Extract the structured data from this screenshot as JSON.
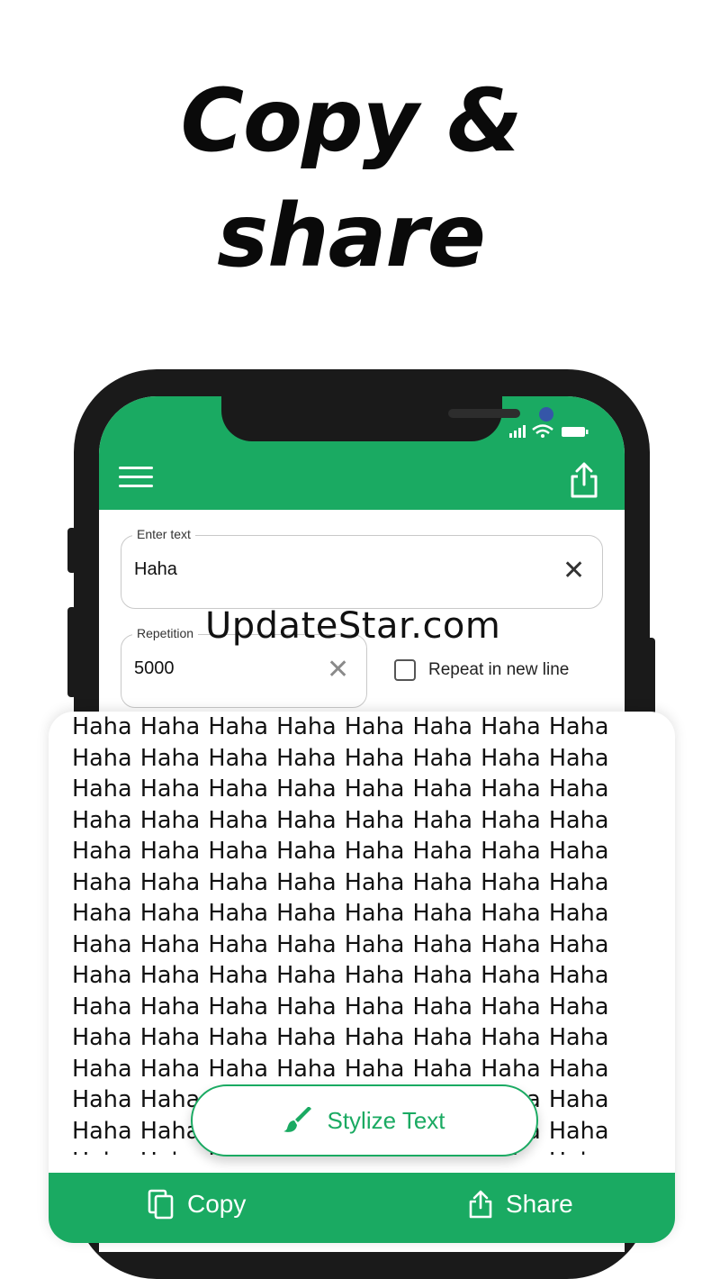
{
  "headline": {
    "line1": "Copy &",
    "line2": "share"
  },
  "app": {
    "menu_icon": "hamburger-menu-icon",
    "share_icon": "share-upload-icon",
    "enter_text": {
      "label": "Enter text",
      "value": "Haha"
    },
    "repetition": {
      "label": "Repetition",
      "value": "5000"
    },
    "repeat_new_line": {
      "label": "Repeat in new line",
      "checked": false
    },
    "output": {
      "word": "Haha",
      "words_per_line": 8
    },
    "stylize_button": {
      "label": "Stylize Text",
      "icon": "paint-brush-icon"
    },
    "bottom": {
      "copy_label": "Copy",
      "share_label": "Share"
    }
  },
  "watermark": "UpdateStar.com",
  "colors": {
    "accent": "#1aaa62",
    "frame": "#1a1a1a",
    "camera": "#3556a8"
  }
}
